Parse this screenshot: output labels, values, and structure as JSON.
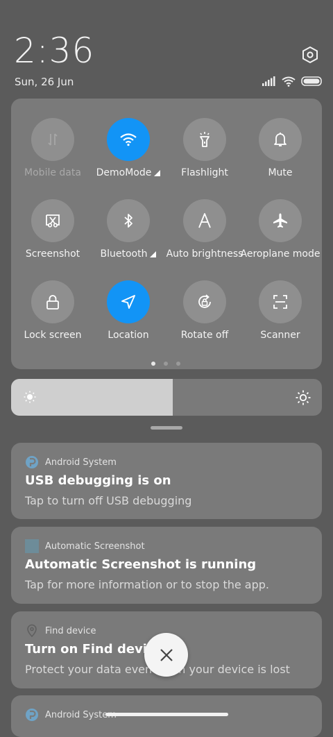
{
  "status": {
    "time": "2:36",
    "date": "Sun, 26 Jun"
  },
  "icons": {
    "settings": "settings-hexagon-icon",
    "signal": "signal-icon",
    "wifi": "wifi-icon",
    "battery": "battery-icon"
  },
  "quick_settings": {
    "tiles": [
      {
        "label": "Mobile data",
        "icon": "mobile-data-icon",
        "active": false,
        "disabled": true
      },
      {
        "label": "DemoMode",
        "icon": "wifi-icon",
        "active": true,
        "has_menu": true
      },
      {
        "label": "Flashlight",
        "icon": "flashlight-icon",
        "active": false
      },
      {
        "label": "Mute",
        "icon": "bell-icon",
        "active": false
      },
      {
        "label": "Screenshot",
        "icon": "screenshot-icon",
        "active": false
      },
      {
        "label": "Bluetooth",
        "icon": "bluetooth-icon",
        "active": false,
        "has_menu": true
      },
      {
        "label": "Auto brightness",
        "icon": "auto-brightness-icon",
        "active": false
      },
      {
        "label": "Aeroplane mode",
        "icon": "airplane-icon",
        "active": false
      },
      {
        "label": "Lock screen",
        "icon": "lock-icon",
        "active": false
      },
      {
        "label": "Location",
        "icon": "location-icon",
        "active": true
      },
      {
        "label": "Rotate off",
        "icon": "rotate-lock-icon",
        "active": false
      },
      {
        "label": "Scanner",
        "icon": "scanner-icon",
        "active": false
      }
    ],
    "page_count": 3,
    "current_page": 1
  },
  "brightness": {
    "level": 0.52
  },
  "notifications": [
    {
      "app": "Android System",
      "title": "USB debugging is on",
      "text": "Tap to turn off USB debugging"
    },
    {
      "app": "Automatic Screenshot",
      "title": "Automatic Screenshot is running",
      "text": "Tap for more information or to stop the app."
    },
    {
      "app": "Find device",
      "title": "Turn on Find device",
      "text": "Protect your data even when your device is lost"
    },
    {
      "app": "Android System",
      "title": "",
      "text": ""
    }
  ],
  "colors": {
    "active_tile": "#1294f6",
    "panel": "#7a7a7a",
    "background": "#5b5b5b"
  }
}
